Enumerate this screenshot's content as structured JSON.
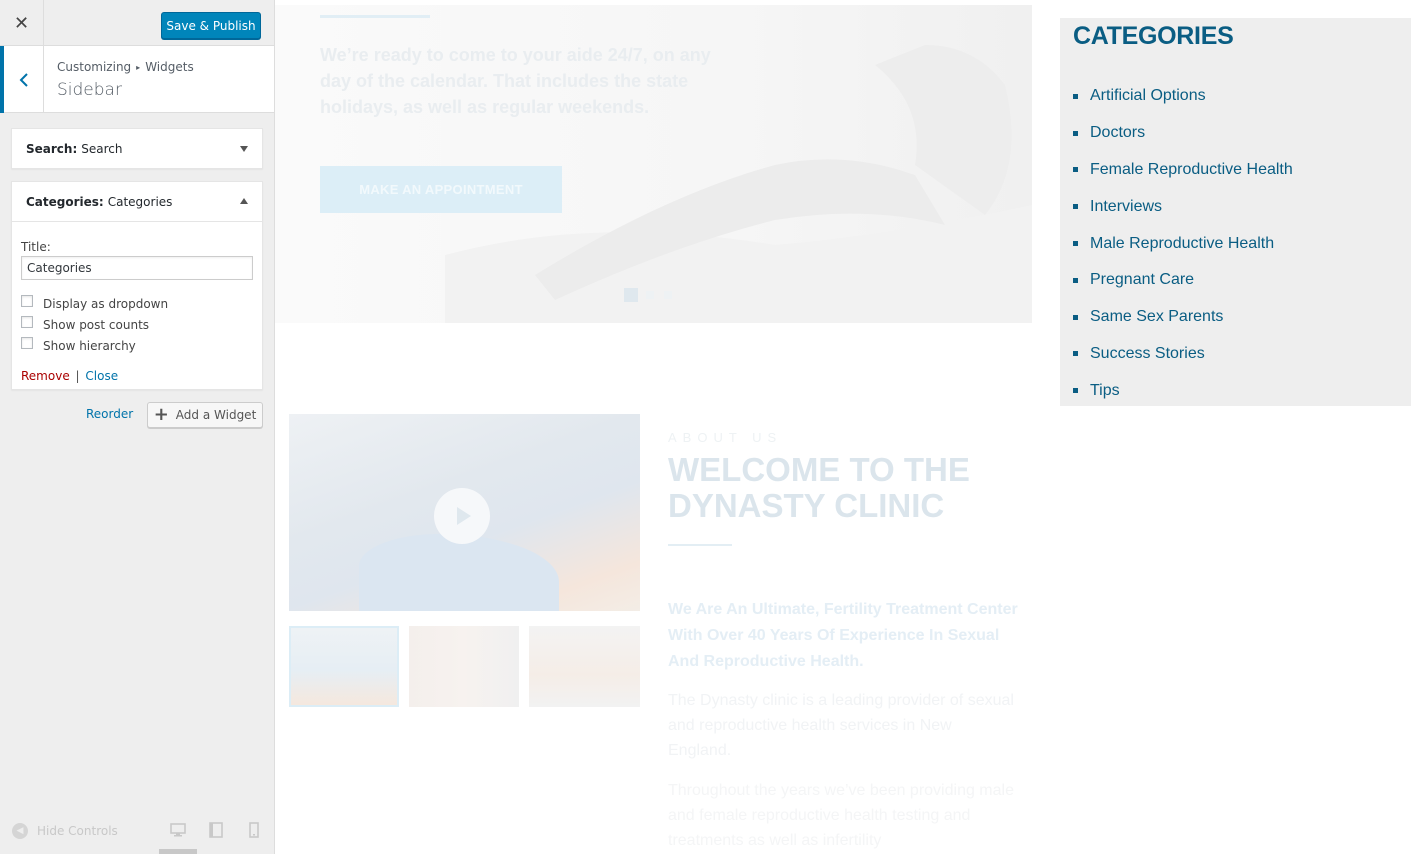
{
  "header": {
    "close_symbol": "✕",
    "publish_label": "Save & Publish"
  },
  "section": {
    "breadcrumb_root": "Customizing",
    "breadcrumb_child": "Widgets",
    "title": "Sidebar"
  },
  "widgets": [
    {
      "name": "Search:",
      "title": "Search",
      "expanded": false
    },
    {
      "name": "Categories:",
      "title": "Categories",
      "expanded": true
    }
  ],
  "categories_form": {
    "title_label": "Title:",
    "title_value": "Categories",
    "options": [
      {
        "label": "Display as dropdown",
        "checked": false
      },
      {
        "label": "Show post counts",
        "checked": false
      },
      {
        "label": "Show hierarchy",
        "checked": false
      }
    ],
    "remove_label": "Remove",
    "separator": "|",
    "close_label": "Close"
  },
  "panel_actions": {
    "reorder_label": "Reorder",
    "add_widget_label": "Add a Widget"
  },
  "footer": {
    "hide_controls_label": "Hide Controls",
    "devices": [
      "desktop-icon",
      "tablet-icon",
      "mobile-icon"
    ]
  },
  "preview": {
    "hero": {
      "text": "We’re ready to come to your aide 24/7, on any day of the calendar. That includes the state holidays, as well as regular weekends.",
      "button_label": "MAKE AN APPOINTMENT"
    },
    "about": {
      "kicker": "ABOUT US",
      "title": "WELCOME TO THE DYNASTY CLINIC",
      "lead": "We Are An Ultimate, Fertility Treatment Center With Over 40 Years Of Experience In Sexual And Reproductive Health.",
      "para1": "The Dynasty clinic is a leading provider of sexual and reproductive health services in New England.",
      "para2": "Throughout the years we’ve been providing male and female reproductive health testing and treatments as well as infertility"
    },
    "sidebar_widget": {
      "heading": "CATEGORIES",
      "items": [
        "Artificial Options",
        "Doctors",
        "Female Reproductive Health",
        "Interviews",
        "Male Reproductive Health",
        "Pregnant Care",
        "Same Sex Parents",
        "Success Stories",
        "Tips"
      ]
    }
  },
  "colors": {
    "accent": "#0073aa",
    "publish": "#0085ba",
    "category_link": "#0a5d83",
    "remove": "#aa0000"
  }
}
